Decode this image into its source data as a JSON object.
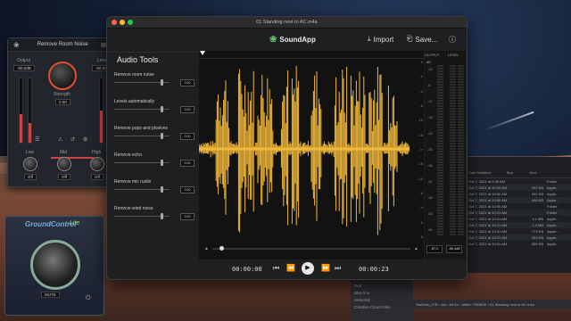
{
  "main_window": {
    "title": "01 Standing next to AC.m4a",
    "brand": "SoundApp",
    "import_label": "Import",
    "save_label": "Save...",
    "tools_title": "Audio Tools",
    "tools": [
      {
        "label": "Remove room noise",
        "value": "0.00"
      },
      {
        "label": "Levels automatically",
        "value": "0.00"
      },
      {
        "label": "Remove pops and plosives",
        "value": "0.00"
      },
      {
        "label": "Remove echo",
        "value": "0.00"
      },
      {
        "label": "Remove mic rustle",
        "value": "0.00"
      },
      {
        "label": "Remove wind noise",
        "value": "0.00"
      }
    ],
    "db_ticks": [
      "0",
      "-2",
      "-4",
      "-6",
      "-10",
      "-16",
      "-∞",
      "-16",
      "-10",
      "-6",
      "-4",
      "-2",
      "0"
    ],
    "meters": {
      "output_label": "OUTPUT",
      "level_label": "LEVEL",
      "db_label": "dB",
      "scale": [
        "-24",
        "-6",
        "-12",
        "-18",
        "-24",
        "-30",
        "-36",
        "-42",
        "-48",
        "-54",
        "-60"
      ],
      "output_value": "-87.0",
      "level_value": "-86.4dB",
      "level_value_2": "-86.4dB"
    },
    "transport": {
      "current_time": "00:00:00",
      "total_time": "00:00:23"
    }
  },
  "room_noise_plugin": {
    "title": "Remove Room Noise",
    "output_label": "Output",
    "level_label": "Level",
    "strength_label": "Strength",
    "output_value": "-60.0dB",
    "level_value": "-60.0dB",
    "strength_value": "0.00",
    "low_label": "Low",
    "mid_label": "Mid",
    "high_label": "High",
    "low_value": "Off",
    "mid_value": "Off",
    "high_value": "Off"
  },
  "ground_control": {
    "title": "GroundControl",
    "subtitle": "Lite",
    "value": "MUTE"
  },
  "finder": {
    "headers": [
      "Date Modified",
      "Size",
      "Kind"
    ],
    "rows": [
      [
        "Oct 7, 2021 at 9:49 AM",
        "",
        "Folder"
      ],
      [
        "Oct 7, 2021 at 10:50 AM",
        "492 KB",
        "Apple..."
      ],
      [
        "Oct 7, 2021 at 10:50 AM",
        "342 KB",
        "Apple..."
      ],
      [
        "Oct 7, 2021 at 10:50 AM",
        "448 KB",
        "Apple..."
      ],
      [
        "Oct 7, 2021 at 10:50 AM",
        "",
        "Folder"
      ],
      [
        "Oct 7, 2021 at 10:31 AM",
        "",
        "Folder"
      ],
      [
        "Oct 7, 2021 at 10:31 AM",
        "3.1 MB",
        "Apple..."
      ],
      [
        "Oct 7, 2021 at 10:31 AM",
        "1.3 MB",
        "Apple..."
      ],
      [
        "Oct 7, 2021 at 10:31 AM",
        "773 KB",
        "Apple..."
      ],
      [
        "Oct 7, 2021 at 10:31 AM",
        "283 KB",
        "Apple..."
      ],
      [
        "Oct 7, 2021 at 10:31 AM",
        "265 KB",
        "Apple..."
      ]
    ],
    "sidebar_items": [
      "Red",
      "Blue line",
      "Selected",
      "Creative Cloud Files"
    ],
    "path": "SanDisk_2TB › Job › All Ev › Mater › RWAVE › 01 Standing next to AC.m4a"
  },
  "colors": {
    "waveform": "#f2b93b",
    "accent_green": "#5fc36b",
    "plugin_red": "#e05030"
  }
}
